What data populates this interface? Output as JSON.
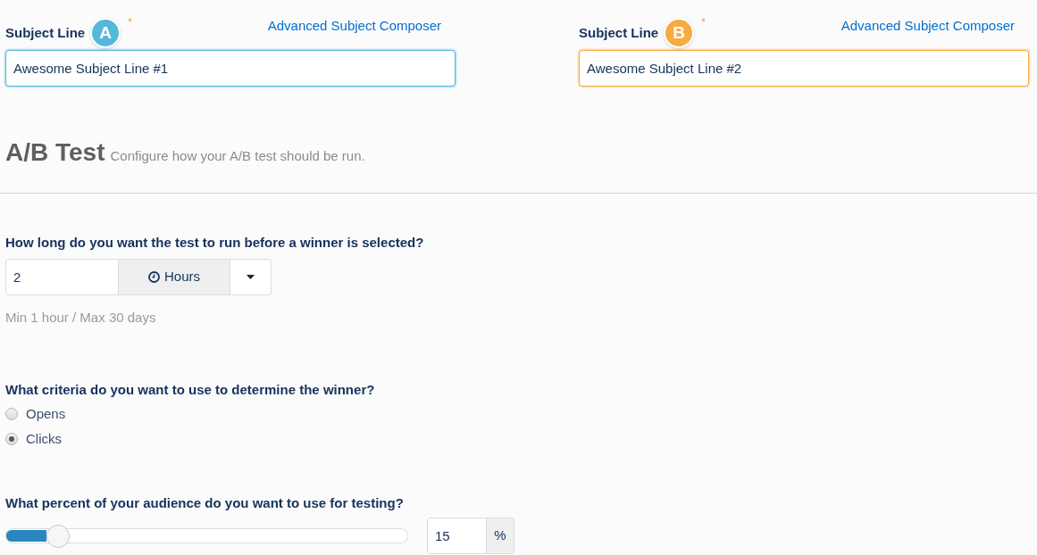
{
  "subject_lines": [
    {
      "label": "Subject Line",
      "badge": "A",
      "color": "#54b8da",
      "required_mark": "*",
      "link": "Advanced Subject Composer",
      "value": "Awesome Subject Line #1"
    },
    {
      "label": "Subject Line",
      "badge": "B",
      "color": "#f7ab42",
      "required_mark": "*",
      "link": "Advanced Subject Composer",
      "value": "Awesome Subject Line #2"
    }
  ],
  "ab_test": {
    "title": "A/B Test",
    "subtitle": "Configure how your A/B test should be run."
  },
  "duration": {
    "question": "How long do you want the test to run before a winner is selected?",
    "value": "2",
    "unit": "Hours",
    "hint": "Min 1 hour / Max 30 days"
  },
  "criteria": {
    "question": "What criteria do you want to use to determine the winner?",
    "options": [
      {
        "label": "Opens",
        "selected": false
      },
      {
        "label": "Clicks",
        "selected": true
      }
    ]
  },
  "audience": {
    "question": "What percent of your audience do you want to use for testing?",
    "level": 0.13,
    "value": "15",
    "unit": "%"
  }
}
